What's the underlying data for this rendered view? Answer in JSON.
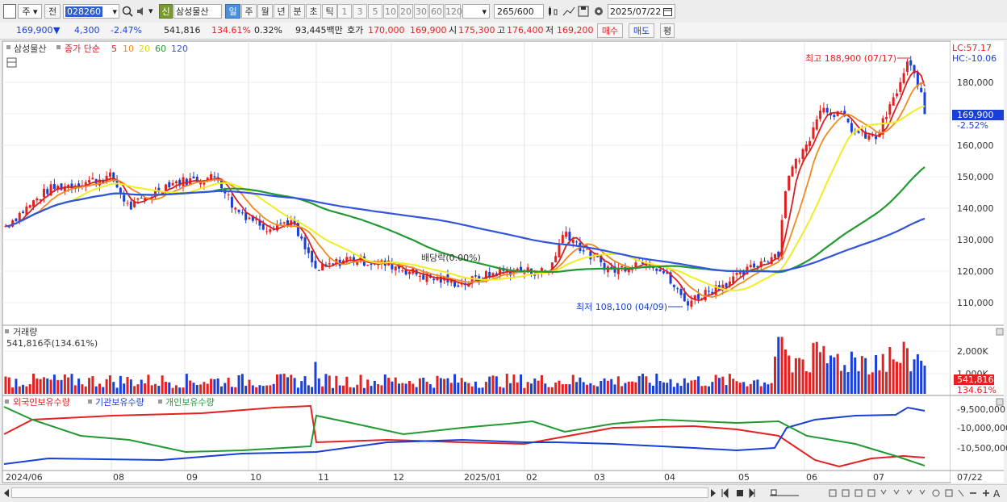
{
  "toolbar": {
    "period_day": "주",
    "prev_label": "전",
    "code": "028260",
    "new_badge": "신",
    "stock_name": "삼성물산",
    "periods": [
      "일",
      "주",
      "월",
      "년",
      "분",
      "초",
      "틱"
    ],
    "intervals": [
      "1",
      "3",
      "5",
      "10",
      "20",
      "30",
      "60",
      "120"
    ],
    "count": "265",
    "count_total": "/600",
    "date": "2025/07/22"
  },
  "quote": {
    "price": "169,900",
    "change": "4,300",
    "change_pct": "-2.47%",
    "volume": "541,816",
    "volume_ratio": "134.61%",
    "turnover": "0.32%",
    "amount": "93,445백만",
    "ask_label": "호가",
    "ask": "170,000",
    "bid": "169,900",
    "open_label": "시",
    "open": "175,300",
    "high_label": "고",
    "high": "176,400",
    "low_label": "저",
    "low": "169,200",
    "buy_label": "매수",
    "sell_label": "매도",
    "eval_label": "평"
  },
  "price_panel": {
    "name": "삼성물산",
    "legend": "종가 단순",
    "ma": [
      "5",
      "10",
      "20",
      "60",
      "120"
    ],
    "lc": "LC:57.17",
    "hc": "HC:-10.06",
    "max_label": "최고 188,900 (07/17)",
    "min_label": "최저 108,100 (04/09)",
    "dividend_label": "배당락(0.00%)",
    "current_price": "169,900",
    "current_pct": "-2.52%",
    "yticks": [
      "180,000",
      "170,000",
      "160,000",
      "150,000",
      "140,000",
      "130,000",
      "120,000",
      "110,000"
    ]
  },
  "volume_panel": {
    "title": "거래량",
    "info": "541,816주(134.61%)",
    "yticks": [
      "2,000K",
      "1,000K"
    ],
    "current": "541,816",
    "current_pct": "134.61%"
  },
  "holding_panel": {
    "items": [
      "외국인보유수량",
      "기관보유수량",
      "개인보유수량"
    ],
    "yticks": [
      "-9,500,000",
      "-10,000,000",
      "-10,500,000"
    ]
  },
  "xaxis": [
    "2024/06",
    "08",
    "09",
    "10",
    "11",
    "12",
    "2025/01",
    "02",
    "03",
    "04",
    "05",
    "06",
    "07",
    "07/22"
  ],
  "colors": {
    "up": "#e52020",
    "down": "#1a3fd6",
    "ma5": "#dd1e1e",
    "ma10": "#f08a1e",
    "ma20": "#eeee22",
    "ma60": "#229933",
    "ma120": "#3355dd",
    "highlight": "#4a8fe0"
  },
  "chart_data": {
    "type": "candlestick",
    "ylim": [
      104000,
      193000
    ],
    "points": [
      {
        "x": "2024/06",
        "y": 134000
      },
      {
        "x": "2024/07",
        "y": 150000
      },
      {
        "x": "2024/08",
        "y": 150000
      },
      {
        "x": "2024/09",
        "y": 148000
      },
      {
        "x": "2024/10",
        "y": 132000
      },
      {
        "x": "2024/11",
        "y": 118000
      },
      {
        "x": "2024/12",
        "y": 122000
      },
      {
        "x": "2025/01",
        "y": 116000
      },
      {
        "x": "2025/02",
        "y": 132000
      },
      {
        "x": "2025/03",
        "y": 120000
      },
      {
        "x": "2025/04",
        "y": 112000
      },
      {
        "x": "2025/05",
        "y": 123000
      },
      {
        "x": "2025/06",
        "y": 172000
      },
      {
        "x": "2025/07",
        "y": 188900
      },
      {
        "x": "2025/07/22",
        "y": 169900
      }
    ],
    "max": {
      "date": "07/17",
      "value": 188900
    },
    "min": {
      "date": "04/09",
      "value": 108100
    },
    "last": 169900
  }
}
